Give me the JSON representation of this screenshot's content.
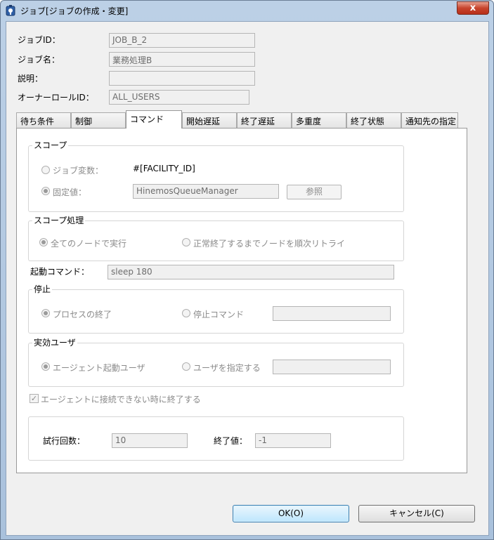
{
  "window": {
    "title": "ジョブ[ジョブの作成・変更]",
    "close_label": "x"
  },
  "form": {
    "job_id_label": "ジョブID：",
    "job_id_value": "JOB_B_2",
    "job_name_label": "ジョブ名：",
    "job_name_value": "業務処理B",
    "description_label": "説明：",
    "description_value": "",
    "owner_role_label": "オーナーロールID：",
    "owner_role_value": "ALL_USERS"
  },
  "tabs": [
    {
      "label": "待ち条件"
    },
    {
      "label": "制御"
    },
    {
      "label": "コマンド"
    },
    {
      "label": "開始遅延"
    },
    {
      "label": "終了遅延"
    },
    {
      "label": "多重度"
    },
    {
      "label": "終了状態"
    },
    {
      "label": "通知先の指定"
    }
  ],
  "active_tab": "コマンド",
  "scope": {
    "title": "スコープ",
    "job_variable_label": "ジョブ変数：",
    "job_variable_value": "#[FACILITY_ID]",
    "fixed_value_label": "固定値：",
    "fixed_value_value": "HinemosQueueManager",
    "browse_label": "参照"
  },
  "scope_processing": {
    "title": "スコープ処理",
    "all_nodes_label": "全てのノードで実行",
    "retry_label": "正常終了するまでノードを順次リトライ"
  },
  "start_command": {
    "label": "起動コマンド：",
    "value": "sleep 180"
  },
  "stop": {
    "title": "停止",
    "process_end_label": "プロセスの終了",
    "stop_command_label": "停止コマンド",
    "stop_command_value": ""
  },
  "effective_user": {
    "title": "実効ユーザ",
    "agent_user_label": "エージェント起動ユーザ",
    "specify_user_label": "ユーザを指定する",
    "specify_user_value": ""
  },
  "agent_fail": {
    "label": "エージェントに接続できない時に終了する",
    "checked": true,
    "retry_count_label": "試行回数：",
    "retry_count_value": "10",
    "end_value_label": "終了値：",
    "end_value_value": "-1"
  },
  "buttons": {
    "ok": "OK(O)",
    "cancel": "キャンセル(C)"
  }
}
